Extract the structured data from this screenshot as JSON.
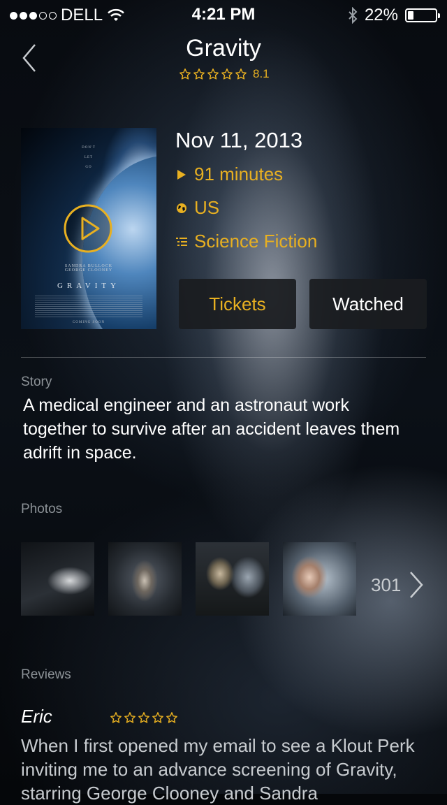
{
  "status_bar": {
    "carrier": "DELL",
    "time": "4:21 PM",
    "battery": "22%",
    "battery_level": 0.22,
    "signal_bars": 3
  },
  "header": {
    "title": "Gravity",
    "rating": "8.1",
    "star_count": 5
  },
  "movie": {
    "release_date": "Nov 11, 2013",
    "duration": "91 minutes",
    "country": "US",
    "genre": "Science Fiction",
    "poster": {
      "title": "GRAVITY",
      "cast": "SANDRA BULLOCK\nGEORGE CLOONEY",
      "tagline": "DON'T\nLET\nGO",
      "footer": "COMING SOON"
    }
  },
  "actions": {
    "tickets": "Tickets",
    "watched": "Watched"
  },
  "story": {
    "heading": "Story",
    "text": "A medical engineer and an astronaut work together to survive after an accident leaves them adrift in space."
  },
  "photos": {
    "heading": "Photos",
    "count": "301"
  },
  "reviews": {
    "heading": "Reviews",
    "items": [
      {
        "author": "Eric",
        "stars": 5,
        "text": "When I first opened my email to see a Klout Perk inviting me to an advance screening of Gravity, starring George Clooney and Sandra"
      }
    ]
  },
  "colors": {
    "accent": "#e8b021",
    "button_bg": "#1a1c1f",
    "muted_text": "#8c9297"
  }
}
